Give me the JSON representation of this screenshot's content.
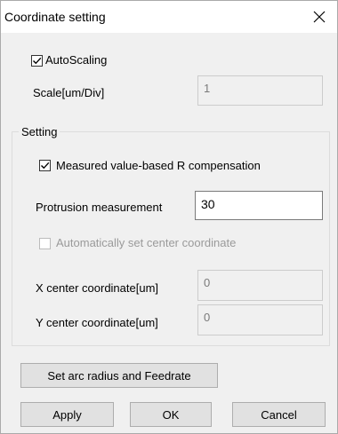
{
  "window": {
    "title": "Coordinate setting",
    "close_icon": "close-icon"
  },
  "autoscaling": {
    "label": "AutoScaling",
    "checked": true
  },
  "scale": {
    "label": "Scale[um/Div]",
    "value": "1"
  },
  "setting_group": {
    "legend": "Setting",
    "r_compensation": {
      "label": "Measured value-based R compensation",
      "checked": true
    },
    "protrusion": {
      "label": "Protrusion measurement",
      "value": "30"
    },
    "auto_center": {
      "label": "Automatically set center coordinate",
      "checked": false
    },
    "x_center": {
      "label": "X center coordinate[um]",
      "value": "0"
    },
    "y_center": {
      "label": "Y center coordinate[um]",
      "value": "0"
    }
  },
  "buttons": {
    "arc_radius": "Set arc radius and Feedrate",
    "apply": "Apply",
    "ok": "OK",
    "cancel": "Cancel"
  }
}
